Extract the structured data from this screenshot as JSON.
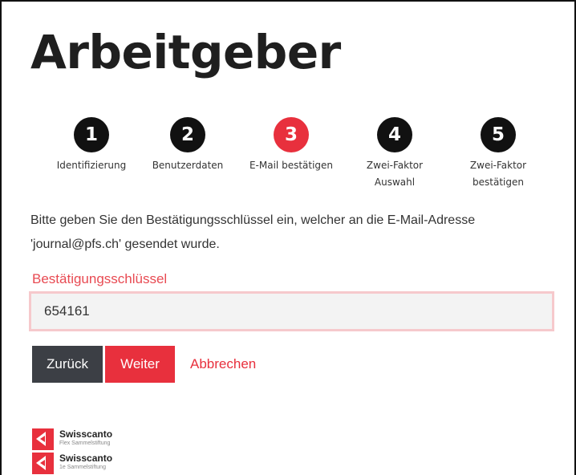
{
  "page": {
    "title": "Arbeitgeber"
  },
  "steps": [
    {
      "number": "1",
      "label": "Identifizierung",
      "active": false
    },
    {
      "number": "2",
      "label": "Benutzerdaten",
      "active": false
    },
    {
      "number": "3",
      "label": "E-Mail bestätigen",
      "active": true
    },
    {
      "number": "4",
      "label_line1": "Zwei-Faktor",
      "label_line2": "Auswahl",
      "active": false
    },
    {
      "number": "5",
      "label_line1": "Zwei-Faktor",
      "label_line2": "bestätigen",
      "active": false
    }
  ],
  "form": {
    "intro_line1": "Bitte geben Sie den Bestätigungsschlüssel ein, welcher an die E-Mail-Adresse",
    "intro_line2": "'journal@pfs.ch' gesendet wurde.",
    "field_label": "Bestätigungsschlüssel",
    "field_value": "654161"
  },
  "buttons": {
    "back": "Zurück",
    "next": "Weiter",
    "cancel": "Abbrechen"
  },
  "logos": [
    {
      "name": "Swisscanto",
      "sub": "Flex Sammelstiftung"
    },
    {
      "name": "Swisscanto",
      "sub": "1e Sammelstiftung"
    }
  ],
  "colors": {
    "accent": "#e8303d",
    "step_inactive": "#111111",
    "back_button": "#3c3f45",
    "input_border": "#f6c9cc"
  }
}
